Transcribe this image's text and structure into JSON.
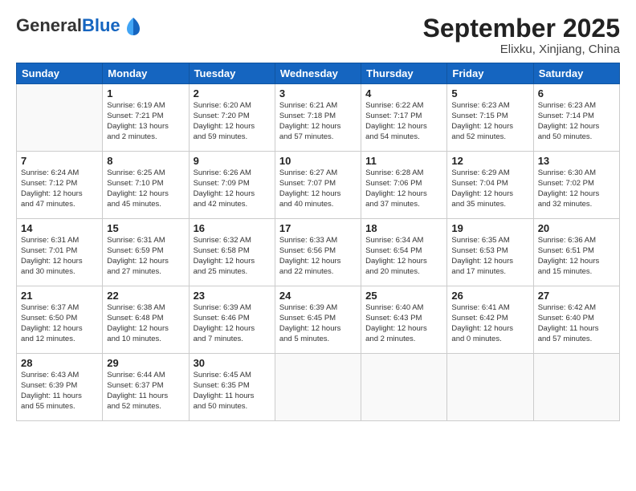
{
  "header": {
    "logo_general": "General",
    "logo_blue": "Blue",
    "month": "September 2025",
    "location": "Elixku, Xinjiang, China"
  },
  "weekdays": [
    "Sunday",
    "Monday",
    "Tuesday",
    "Wednesday",
    "Thursday",
    "Friday",
    "Saturday"
  ],
  "weeks": [
    [
      {
        "day": "",
        "info": ""
      },
      {
        "day": "1",
        "info": "Sunrise: 6:19 AM\nSunset: 7:21 PM\nDaylight: 13 hours\nand 2 minutes."
      },
      {
        "day": "2",
        "info": "Sunrise: 6:20 AM\nSunset: 7:20 PM\nDaylight: 12 hours\nand 59 minutes."
      },
      {
        "day": "3",
        "info": "Sunrise: 6:21 AM\nSunset: 7:18 PM\nDaylight: 12 hours\nand 57 minutes."
      },
      {
        "day": "4",
        "info": "Sunrise: 6:22 AM\nSunset: 7:17 PM\nDaylight: 12 hours\nand 54 minutes."
      },
      {
        "day": "5",
        "info": "Sunrise: 6:23 AM\nSunset: 7:15 PM\nDaylight: 12 hours\nand 52 minutes."
      },
      {
        "day": "6",
        "info": "Sunrise: 6:23 AM\nSunset: 7:14 PM\nDaylight: 12 hours\nand 50 minutes."
      }
    ],
    [
      {
        "day": "7",
        "info": "Sunrise: 6:24 AM\nSunset: 7:12 PM\nDaylight: 12 hours\nand 47 minutes."
      },
      {
        "day": "8",
        "info": "Sunrise: 6:25 AM\nSunset: 7:10 PM\nDaylight: 12 hours\nand 45 minutes."
      },
      {
        "day": "9",
        "info": "Sunrise: 6:26 AM\nSunset: 7:09 PM\nDaylight: 12 hours\nand 42 minutes."
      },
      {
        "day": "10",
        "info": "Sunrise: 6:27 AM\nSunset: 7:07 PM\nDaylight: 12 hours\nand 40 minutes."
      },
      {
        "day": "11",
        "info": "Sunrise: 6:28 AM\nSunset: 7:06 PM\nDaylight: 12 hours\nand 37 minutes."
      },
      {
        "day": "12",
        "info": "Sunrise: 6:29 AM\nSunset: 7:04 PM\nDaylight: 12 hours\nand 35 minutes."
      },
      {
        "day": "13",
        "info": "Sunrise: 6:30 AM\nSunset: 7:02 PM\nDaylight: 12 hours\nand 32 minutes."
      }
    ],
    [
      {
        "day": "14",
        "info": "Sunrise: 6:31 AM\nSunset: 7:01 PM\nDaylight: 12 hours\nand 30 minutes."
      },
      {
        "day": "15",
        "info": "Sunrise: 6:31 AM\nSunset: 6:59 PM\nDaylight: 12 hours\nand 27 minutes."
      },
      {
        "day": "16",
        "info": "Sunrise: 6:32 AM\nSunset: 6:58 PM\nDaylight: 12 hours\nand 25 minutes."
      },
      {
        "day": "17",
        "info": "Sunrise: 6:33 AM\nSunset: 6:56 PM\nDaylight: 12 hours\nand 22 minutes."
      },
      {
        "day": "18",
        "info": "Sunrise: 6:34 AM\nSunset: 6:54 PM\nDaylight: 12 hours\nand 20 minutes."
      },
      {
        "day": "19",
        "info": "Sunrise: 6:35 AM\nSunset: 6:53 PM\nDaylight: 12 hours\nand 17 minutes."
      },
      {
        "day": "20",
        "info": "Sunrise: 6:36 AM\nSunset: 6:51 PM\nDaylight: 12 hours\nand 15 minutes."
      }
    ],
    [
      {
        "day": "21",
        "info": "Sunrise: 6:37 AM\nSunset: 6:50 PM\nDaylight: 12 hours\nand 12 minutes."
      },
      {
        "day": "22",
        "info": "Sunrise: 6:38 AM\nSunset: 6:48 PM\nDaylight: 12 hours\nand 10 minutes."
      },
      {
        "day": "23",
        "info": "Sunrise: 6:39 AM\nSunset: 6:46 PM\nDaylight: 12 hours\nand 7 minutes."
      },
      {
        "day": "24",
        "info": "Sunrise: 6:39 AM\nSunset: 6:45 PM\nDaylight: 12 hours\nand 5 minutes."
      },
      {
        "day": "25",
        "info": "Sunrise: 6:40 AM\nSunset: 6:43 PM\nDaylight: 12 hours\nand 2 minutes."
      },
      {
        "day": "26",
        "info": "Sunrise: 6:41 AM\nSunset: 6:42 PM\nDaylight: 12 hours\nand 0 minutes."
      },
      {
        "day": "27",
        "info": "Sunrise: 6:42 AM\nSunset: 6:40 PM\nDaylight: 11 hours\nand 57 minutes."
      }
    ],
    [
      {
        "day": "28",
        "info": "Sunrise: 6:43 AM\nSunset: 6:39 PM\nDaylight: 11 hours\nand 55 minutes."
      },
      {
        "day": "29",
        "info": "Sunrise: 6:44 AM\nSunset: 6:37 PM\nDaylight: 11 hours\nand 52 minutes."
      },
      {
        "day": "30",
        "info": "Sunrise: 6:45 AM\nSunset: 6:35 PM\nDaylight: 11 hours\nand 50 minutes."
      },
      {
        "day": "",
        "info": ""
      },
      {
        "day": "",
        "info": ""
      },
      {
        "day": "",
        "info": ""
      },
      {
        "day": "",
        "info": ""
      }
    ]
  ]
}
